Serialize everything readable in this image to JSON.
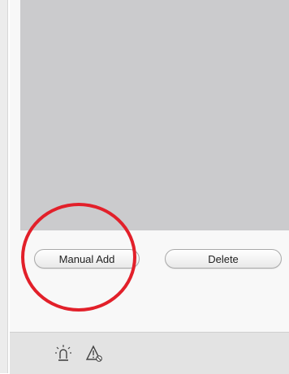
{
  "actions": {
    "manual_add_label": "Manual Add",
    "delete_label": "Delete"
  },
  "status_bar": {
    "icons": [
      "alarm-light-icon",
      "warning-muted-icon"
    ]
  },
  "colors": {
    "list_area_background": "#cbcbcd",
    "panel_background": "#f8f8f8",
    "status_bar_background": "#e3e3e3",
    "highlight_ring": "#e2202a",
    "icon_stroke": "#444444"
  }
}
